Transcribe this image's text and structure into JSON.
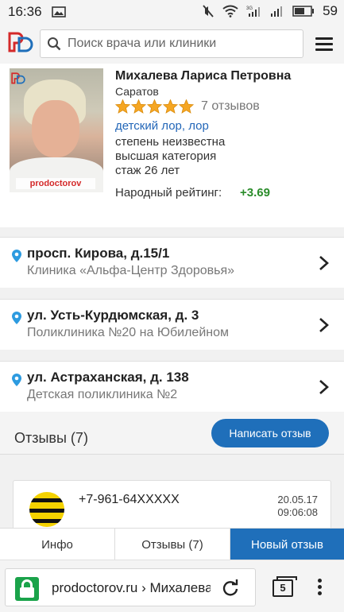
{
  "status_bar": {
    "time": "16:36",
    "battery": "59"
  },
  "header": {
    "search_placeholder": "Поиск врача или клиники"
  },
  "doctor": {
    "name": "Михалева Лариса Петровна",
    "city": "Саратов",
    "rating_stars": 5,
    "reviews_count": "7 отзывов",
    "specialty": "детский лор, лор",
    "degree": "степень неизвестна",
    "category": "высшая категория",
    "experience": "стаж 26 лет",
    "rating_label": "Народный рейтинг:",
    "rating_value": "+3.69",
    "photo_watermark": "prodoctorov"
  },
  "addresses": [
    {
      "street": "просп. Кирова, д.15/1",
      "clinic": "Клиника «Альфа-Центр Здоровья»"
    },
    {
      "street": "ул. Усть-Курдюмская, д. 3",
      "clinic": "Поликлиника №20 на Юбилейном"
    },
    {
      "street": "ул. Астраханская, д. 138",
      "clinic": "Детская поликлиника №2"
    }
  ],
  "reviews": {
    "title": "Отзывы (7)",
    "write_button": "Написать отзыв",
    "items": [
      {
        "phone": "+7-961-64XXXXX",
        "date": "20.05.17",
        "time": "09:06:08"
      }
    ]
  },
  "tabs": [
    "Инфо",
    "Отзывы (7)",
    "Новый отзыв"
  ],
  "browser": {
    "url": "prodoctorov.ru › Михалева",
    "tab_count": "5"
  },
  "colors": {
    "accent": "#1f6fba",
    "star": "#f5a623",
    "rating_positive": "#2a8c2a",
    "link": "#2266b8",
    "secure": "#1aa34a"
  }
}
